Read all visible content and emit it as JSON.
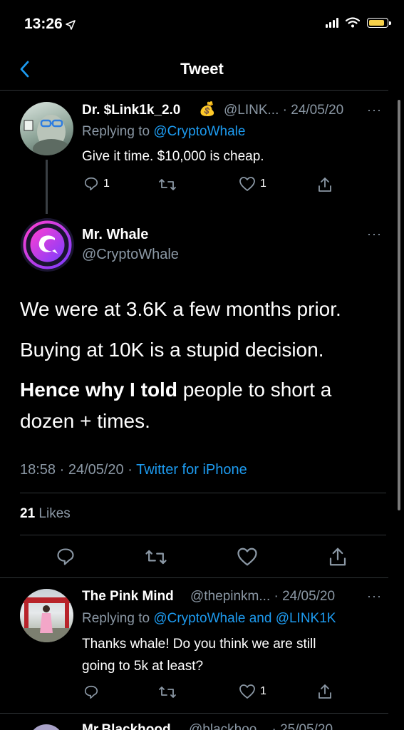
{
  "status_bar": {
    "time": "13:26",
    "battery_level": 0.9
  },
  "header": {
    "title": "Tweet"
  },
  "reply1": {
    "display_name": "Dr. $Link1k_2.0",
    "name_emoji": "💰",
    "handle_date": "@LINK... · 24/05/20",
    "replying_prefix": "Replying to",
    "replying_to": "@CryptoWhale",
    "text": "Give it time. $10,000 is cheap.",
    "reply_count": "1",
    "like_count": "1"
  },
  "main_tweet": {
    "display_name": "Mr. Whale",
    "handle": "@CryptoWhale",
    "line1": "We were at 3.6K a few months prior.",
    "line2": "Buying at 10K is a stupid decision.",
    "line3_bold": "Hence why I told",
    "line3_rest": " people to short a",
    "line4": "dozen + times.",
    "timestamp": "18:58 · 24/05/20 · ",
    "source": "Twitter for iPhone",
    "likes_count": "21",
    "likes_label": "Likes"
  },
  "reply2": {
    "display_name": "The Pink Mind",
    "handle_date": "@thepinkm... · 24/05/20",
    "replying_prefix": "Replying to",
    "replying_to": "@CryptoWhale and @LINK1K",
    "text_line1": "Thanks whale! Do you think we are still",
    "text_line2": "going to 5k at least?",
    "like_count": "1"
  },
  "reply3_partial": {
    "display_name": "Mr.Blackhood",
    "handle_date": "@blackhoo... · 25/05/20"
  },
  "colors": {
    "accent": "#1d9bf0",
    "secondary_text": "#8b98a5",
    "background": "#000000"
  }
}
